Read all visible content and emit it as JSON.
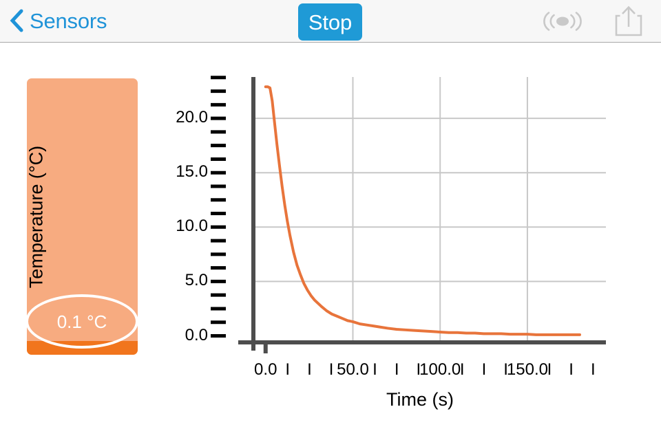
{
  "navbar": {
    "back_label": "Sensors",
    "back_icon": "chevron-left-icon",
    "stop_label": "Stop",
    "stop_color": "#1f9ad6",
    "accent_color": "#1f93d8",
    "broadcast_icon": "broadcast-icon",
    "share_icon": "share-upload-icon",
    "disabled_icon_color": "#c9c9c9"
  },
  "gauge": {
    "readout": "0.1 °C",
    "track_color": "#f7ab80",
    "fill_color": "#f1751d",
    "fill_percent": 5,
    "ring_color": "#ffffff"
  },
  "chart_data": {
    "type": "line",
    "title": "",
    "xlabel": "Time (s)",
    "ylabel": "Temperature (°C)",
    "xlim": [
      -7,
      195
    ],
    "ylim": [
      -0.6,
      23.8
    ],
    "xticks": [
      0.0,
      50.0,
      100.0,
      150.0
    ],
    "xtick_labels": [
      "0.0",
      "50.0",
      "100.0",
      "150.0"
    ],
    "yticks": [
      0.0,
      5.0,
      10.0,
      15.0,
      20.0
    ],
    "ytick_labels": [
      "0.0",
      "5.0",
      "10.0",
      "15.0",
      "20.0"
    ],
    "minor_tick_marker": "I",
    "x_minor_per_major": 4,
    "y_minor_per_major": 4,
    "grid": true,
    "grid_color": "#c8c8c8",
    "axis_color": "#4d4d4d",
    "legend": "none",
    "series": [
      {
        "name": "Temperature",
        "color": "#e8743b",
        "x": [
          0,
          1.2,
          2.5,
          3.8,
          5,
          6.5,
          8,
          9.5,
          11,
          12.5,
          14,
          16,
          18,
          20,
          22,
          24,
          26,
          28,
          30,
          32,
          35,
          38,
          41,
          44,
          47,
          50,
          54,
          58,
          62,
          66,
          70,
          75,
          80,
          85,
          90,
          95,
          100,
          105,
          110,
          115,
          120,
          125,
          130,
          135,
          140,
          145,
          150,
          155,
          160,
          165,
          170,
          175,
          180
        ],
        "y": [
          22.9,
          22.9,
          22.8,
          21.6,
          19.8,
          17.6,
          15.6,
          13.7,
          12.0,
          10.5,
          9.2,
          7.7,
          6.5,
          5.6,
          4.8,
          4.2,
          3.7,
          3.3,
          3.0,
          2.7,
          2.3,
          2.0,
          1.8,
          1.6,
          1.4,
          1.3,
          1.1,
          1.0,
          0.9,
          0.8,
          0.7,
          0.6,
          0.55,
          0.5,
          0.45,
          0.4,
          0.35,
          0.3,
          0.3,
          0.25,
          0.25,
          0.2,
          0.2,
          0.2,
          0.15,
          0.15,
          0.15,
          0.1,
          0.1,
          0.1,
          0.1,
          0.1,
          0.1
        ]
      }
    ],
    "notes": "Exponential cooling curve starting at about 22.9 °C and decaying toward 0.1 °C"
  }
}
